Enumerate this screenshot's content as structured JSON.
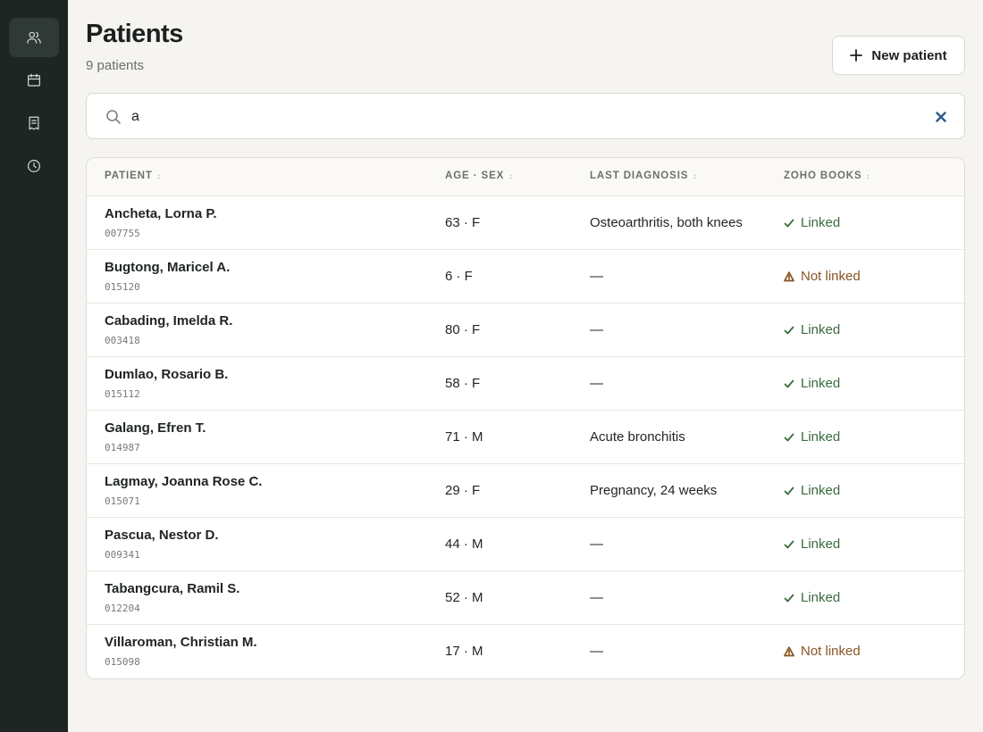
{
  "nav": [
    {
      "icon": "users-icon"
    },
    {
      "icon": "calendar-icon"
    },
    {
      "icon": "receipt-icon"
    },
    {
      "icon": "clock-icon"
    }
  ],
  "header": {
    "title": "Patients",
    "subtitle": "9 patients",
    "new_button_label": "New patient"
  },
  "search": {
    "value": "a",
    "icon": "search-icon",
    "clear_icon": "close-icon"
  },
  "table": {
    "columns": [
      "PATIENT",
      "AGE · SEX",
      "LAST DIAGNOSIS",
      "ZOHO BOOKS"
    ],
    "sort_glyph": "↕",
    "rows": [
      {
        "name": "Ancheta, Lorna P.",
        "id": "007755",
        "age_sex": "63 · F",
        "diagnosis": "Osteoarthritis, both knees",
        "status": "Linked"
      },
      {
        "name": "Bugtong, Maricel A.",
        "id": "015120",
        "age_sex": "6 · F",
        "diagnosis": "—",
        "status": "Not linked"
      },
      {
        "name": "Cabading, Imelda R.",
        "id": "003418",
        "age_sex": "80 · F",
        "diagnosis": "—",
        "status": "Linked"
      },
      {
        "name": "Dumlao, Rosario B.",
        "id": "015112",
        "age_sex": "58 · F",
        "diagnosis": "—",
        "status": "Linked"
      },
      {
        "name": "Galang, Efren T.",
        "id": "014987",
        "age_sex": "71 · M",
        "diagnosis": "Acute bronchitis",
        "status": "Linked"
      },
      {
        "name": "Lagmay, Joanna Rose C.",
        "id": "015071",
        "age_sex": "29 · F",
        "diagnosis": "Pregnancy, 24 weeks",
        "status": "Linked"
      },
      {
        "name": "Pascua, Nestor D.",
        "id": "009341",
        "age_sex": "44 · M",
        "diagnosis": "—",
        "status": "Linked"
      },
      {
        "name": "Tabangcura, Ramil S.",
        "id": "012204",
        "age_sex": "52 · M",
        "diagnosis": "—",
        "status": "Linked"
      },
      {
        "name": "Villaroman, Christian M.",
        "id": "015098",
        "age_sex": "17 · M",
        "diagnosis": "—",
        "status": "Not linked"
      }
    ]
  },
  "colors": {
    "sidebar": "#1e2623",
    "background": "#f5f4f0",
    "linked": "#3b6b3e",
    "not_linked": "#8a5424",
    "clear_icon": "#2d5b8a"
  }
}
